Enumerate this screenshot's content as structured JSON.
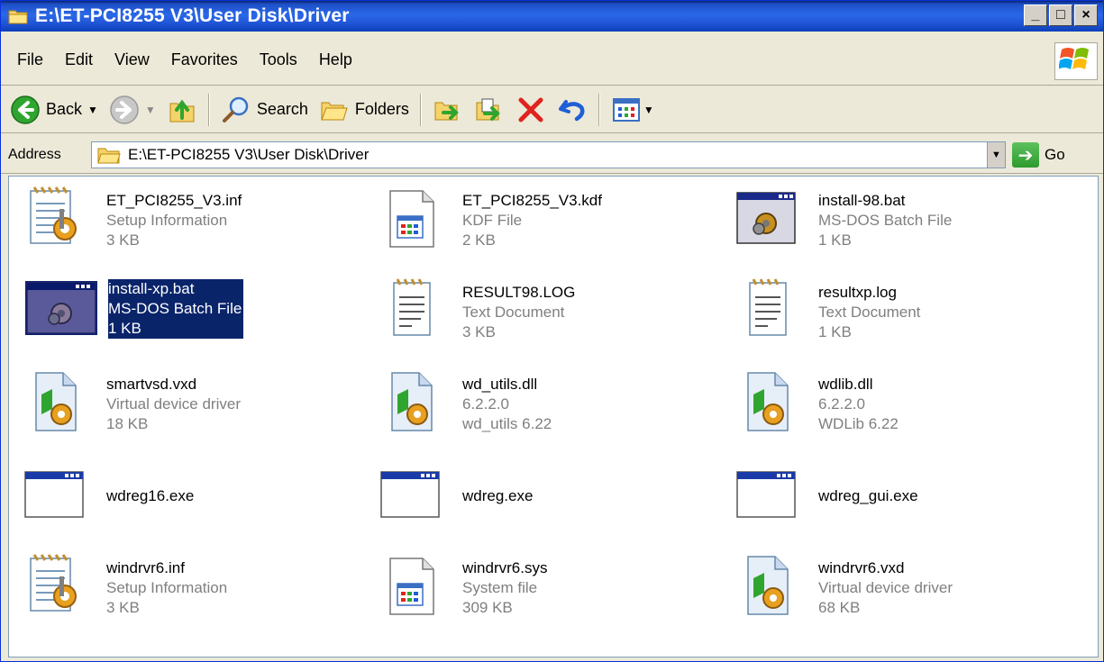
{
  "window": {
    "title": "E:\\ET-PCI8255 V3\\User Disk\\Driver",
    "minimize_glyph": "_",
    "maximize_glyph": "□",
    "close_glyph": "×"
  },
  "menu": {
    "items": [
      "File",
      "Edit",
      "View",
      "Favorites",
      "Tools",
      "Help"
    ]
  },
  "toolbar": {
    "back_label": "Back",
    "search_label": "Search",
    "folders_label": "Folders"
  },
  "address": {
    "label": "Address",
    "value": "E:\\ET-PCI8255 V3\\User Disk\\Driver",
    "go_label": "Go"
  },
  "files": [
    {
      "name": "ET_PCI8255_V3.inf",
      "type": "Setup Information",
      "size": "3 KB",
      "icon": "setup-information-icon"
    },
    {
      "name": "ET_PCI8255_V3.kdf",
      "type": "KDF File",
      "size": "2 KB",
      "icon": "kdf-file-icon"
    },
    {
      "name": "install-98.bat",
      "type": "MS-DOS Batch File",
      "size": "1 KB",
      "icon": "batch-file-icon"
    },
    {
      "name": "install-xp.bat",
      "type": "MS-DOS Batch File",
      "size": "1 KB",
      "icon": "batch-file-icon",
      "selected": true
    },
    {
      "name": "RESULT98.LOG",
      "type": "Text Document",
      "size": "3 KB",
      "icon": "text-document-icon"
    },
    {
      "name": "resultxp.log",
      "type": "Text Document",
      "size": "1 KB",
      "icon": "text-document-icon"
    },
    {
      "name": "smartvsd.vxd",
      "type": "Virtual device driver",
      "size": "18 KB",
      "icon": "system-file-icon"
    },
    {
      "name": "wd_utils.dll",
      "type": "6.2.2.0",
      "size": "wd_utils 6.22",
      "icon": "dll-file-icon"
    },
    {
      "name": "wdlib.dll",
      "type": "6.2.2.0",
      "size": "WDLib 6.22",
      "icon": "dll-file-icon"
    },
    {
      "name": "wdreg16.exe",
      "icon": "application-icon"
    },
    {
      "name": "wdreg.exe",
      "icon": "application-icon"
    },
    {
      "name": "wdreg_gui.exe",
      "icon": "application-icon"
    },
    {
      "name": "windrvr6.inf",
      "type": "Setup Information",
      "size": "3 KB",
      "icon": "setup-information-icon"
    },
    {
      "name": "windrvr6.sys",
      "type": "System file",
      "size": "309 KB",
      "icon": "kdf-file-icon"
    },
    {
      "name": "windrvr6.vxd",
      "type": "Virtual device driver",
      "size": "68 KB",
      "icon": "system-file-icon"
    }
  ]
}
